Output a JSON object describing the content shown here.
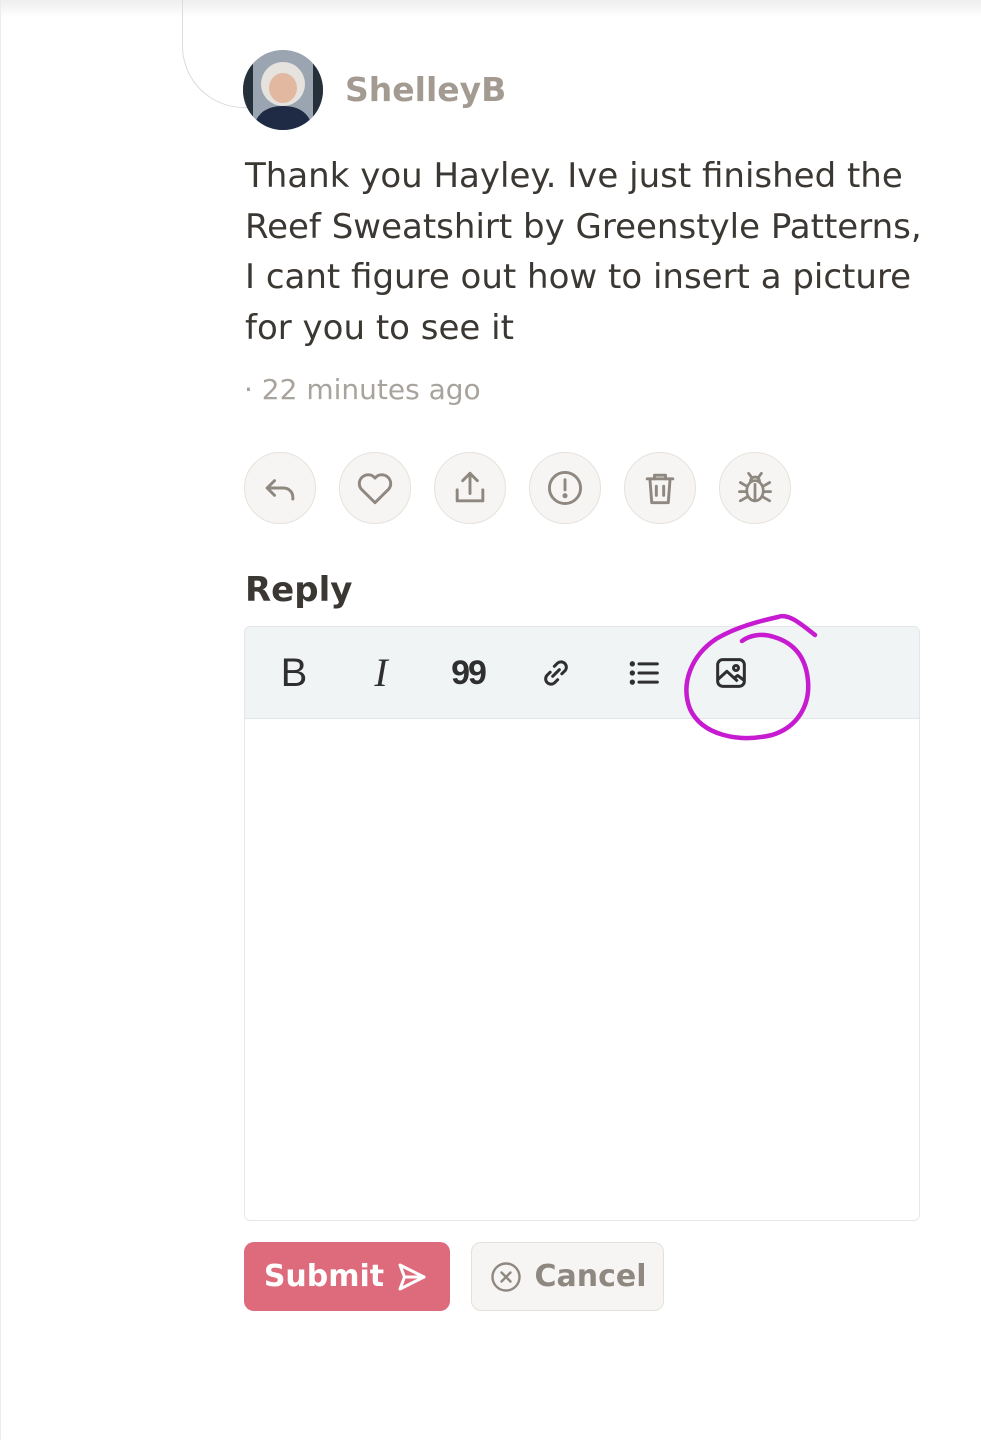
{
  "comment": {
    "author": "ShelleyB",
    "text": "Thank you Hayley. Ive just finished the Reef Sweatshirt by Greenstyle Patterns, I cant figure out how to insert a picture for you to see it",
    "timestamp": "· 22 minutes ago"
  },
  "actions": [
    {
      "name": "reply",
      "icon": "reply-icon"
    },
    {
      "name": "like",
      "icon": "heart-icon"
    },
    {
      "name": "share",
      "icon": "share-icon"
    },
    {
      "name": "report",
      "icon": "alert-circle-icon"
    },
    {
      "name": "delete",
      "icon": "trash-icon"
    },
    {
      "name": "debug",
      "icon": "bug-icon"
    }
  ],
  "reply": {
    "title": "Reply",
    "toolbar": {
      "bold": "B",
      "italic": "I",
      "quote": "99"
    },
    "textarea_value": ""
  },
  "buttons": {
    "submit": "Submit",
    "cancel": "Cancel"
  },
  "colors": {
    "accent": "#dd6b7b",
    "annotation": "#c61bd1",
    "username": "#a39b91"
  }
}
